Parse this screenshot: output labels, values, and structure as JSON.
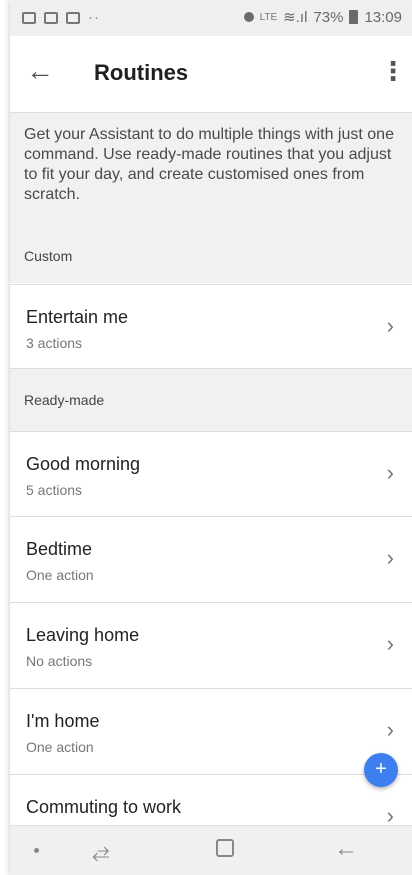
{
  "status_bar": {
    "battery": "73%",
    "time": "13:09",
    "network_label": "LTE"
  },
  "header": {
    "title": "Routines"
  },
  "intro": {
    "text": "Get your Assistant to do multiple things with just one command. Use ready-made routines that you adjust to fit your day, and create customised ones from scratch."
  },
  "sections": {
    "custom_label": "Custom",
    "ready_label": "Ready-made"
  },
  "custom_items": [
    {
      "title": "Entertain me",
      "subtitle": "3 actions"
    }
  ],
  "ready_items": [
    {
      "title": "Good morning",
      "subtitle": "5 actions"
    },
    {
      "title": "Bedtime",
      "subtitle": "One action"
    },
    {
      "title": "Leaving home",
      "subtitle": "No actions"
    },
    {
      "title": "I'm home",
      "subtitle": "One action"
    },
    {
      "title": "Commuting to work",
      "subtitle": ""
    }
  ],
  "fab": {
    "label": "+"
  },
  "icons": {
    "back": "back-arrow-icon",
    "more": "more-vert-icon",
    "chevron": "chevron-right-icon",
    "fab": "plus-icon"
  },
  "colors": {
    "accent": "#3d7ff0",
    "band": "#f1f1f1",
    "divider": "#dcdcdc"
  }
}
